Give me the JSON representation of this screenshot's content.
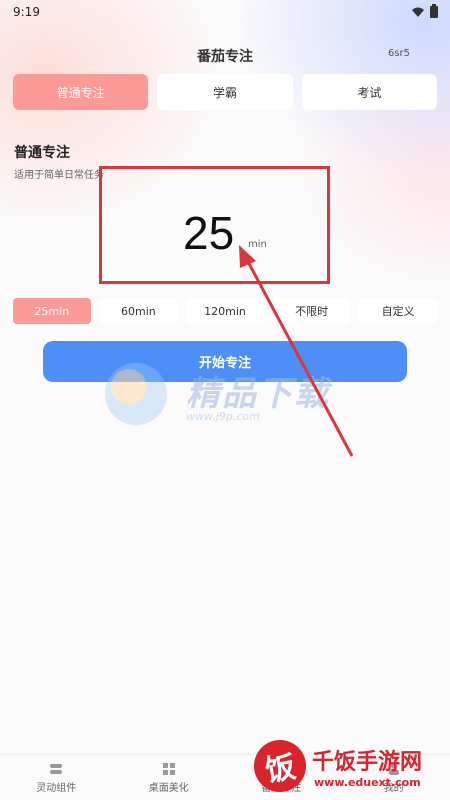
{
  "status_bar": {
    "time": "9:19"
  },
  "header": {
    "title": "番茄专注",
    "version": "6sr5"
  },
  "mode_tabs": [
    {
      "label": "普通专注",
      "active": true
    },
    {
      "label": "学霸",
      "active": false
    },
    {
      "label": "考试",
      "active": false
    }
  ],
  "section": {
    "title": "普通专注",
    "description": "适用于简单日常任务"
  },
  "timer": {
    "value": "25",
    "unit": "min"
  },
  "durations": [
    {
      "label": "25min",
      "active": true
    },
    {
      "label": "60min",
      "active": false
    },
    {
      "label": "120min",
      "active": false
    },
    {
      "label": "不限时",
      "active": false
    },
    {
      "label": "自定义",
      "active": false
    }
  ],
  "start_button": {
    "label": "开始专注"
  },
  "tab_bar": [
    {
      "label": "灵动组件",
      "icon": "widget-icon"
    },
    {
      "label": "桌面美化",
      "icon": "grid-icon"
    },
    {
      "label": "番茄专注",
      "icon": "timer-icon"
    },
    {
      "label": "我的",
      "icon": "user-icon"
    }
  ],
  "watermarks": {
    "center_text": "精品下载",
    "center_url": "www.j9p.com",
    "corner_logo": "饭",
    "corner_text": "千饭手游网",
    "corner_url": "www.eduext.com"
  },
  "colors": {
    "accent_pink": "#fb9a96",
    "primary_blue": "#4d8ff7",
    "annotation_red": "#d9363e"
  }
}
